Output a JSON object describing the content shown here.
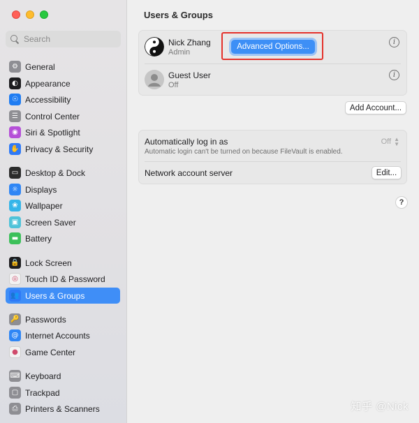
{
  "window": {
    "title": "Users & Groups"
  },
  "sidebar": {
    "search_placeholder": "Search",
    "items": [
      {
        "label": "General",
        "icon": "gear-icon",
        "color": "#8e8e93"
      },
      {
        "label": "Appearance",
        "icon": "appearance-icon",
        "color": "#1d1d1f"
      },
      {
        "label": "Accessibility",
        "icon": "accessibility-icon",
        "color": "#1f7cf2"
      },
      {
        "label": "Control Center",
        "icon": "control-center-icon",
        "color": "#8e8e93"
      },
      {
        "label": "Siri & Spotlight",
        "icon": "siri-icon",
        "color": "#b54fd8"
      },
      {
        "label": "Privacy & Security",
        "icon": "hand-icon",
        "color": "#2f7af7"
      },
      {
        "label": "Desktop & Dock",
        "icon": "dock-icon",
        "color": "#2b2b2b"
      },
      {
        "label": "Displays",
        "icon": "displays-icon",
        "color": "#2f86f5"
      },
      {
        "label": "Wallpaper",
        "icon": "wallpaper-icon",
        "color": "#35b5e9"
      },
      {
        "label": "Screen Saver",
        "icon": "screen-saver-icon",
        "color": "#4fc3d9"
      },
      {
        "label": "Battery",
        "icon": "battery-icon",
        "color": "#3cc05a"
      },
      {
        "label": "Lock Screen",
        "icon": "lock-icon",
        "color": "#1d1d1f"
      },
      {
        "label": "Touch ID & Password",
        "icon": "fingerprint-icon",
        "color": "#f2f2f2"
      },
      {
        "label": "Users & Groups",
        "icon": "users-icon",
        "color": "#2f7af7"
      },
      {
        "label": "Passwords",
        "icon": "key-icon",
        "color": "#8e8e93"
      },
      {
        "label": "Internet Accounts",
        "icon": "at-icon",
        "color": "#2f86f5"
      },
      {
        "label": "Game Center",
        "icon": "game-center-icon",
        "color": "#f2f2f2"
      },
      {
        "label": "Keyboard",
        "icon": "keyboard-icon",
        "color": "#8e8e93"
      },
      {
        "label": "Trackpad",
        "icon": "trackpad-icon",
        "color": "#8e8e93"
      },
      {
        "label": "Printers & Scanners",
        "icon": "printer-icon",
        "color": "#8e8e93"
      }
    ],
    "active": "Users & Groups"
  },
  "users": [
    {
      "name": "Nick Zhang",
      "role": "Admin",
      "avatar": "yin-yang-avatar"
    },
    {
      "name": "Guest User",
      "role": "Off",
      "avatar": "person-avatar"
    }
  ],
  "buttons": {
    "advanced_options": "Advanced Options...",
    "add_account": "Add Account...",
    "edit": "Edit...",
    "help": "?",
    "info": "i"
  },
  "login": {
    "label": "Automatically log in as",
    "value": "Off",
    "note": "Automatic login can't be turned on because FileVault is enabled."
  },
  "network": {
    "label": "Network account server"
  },
  "watermark": "知乎 @Nick"
}
